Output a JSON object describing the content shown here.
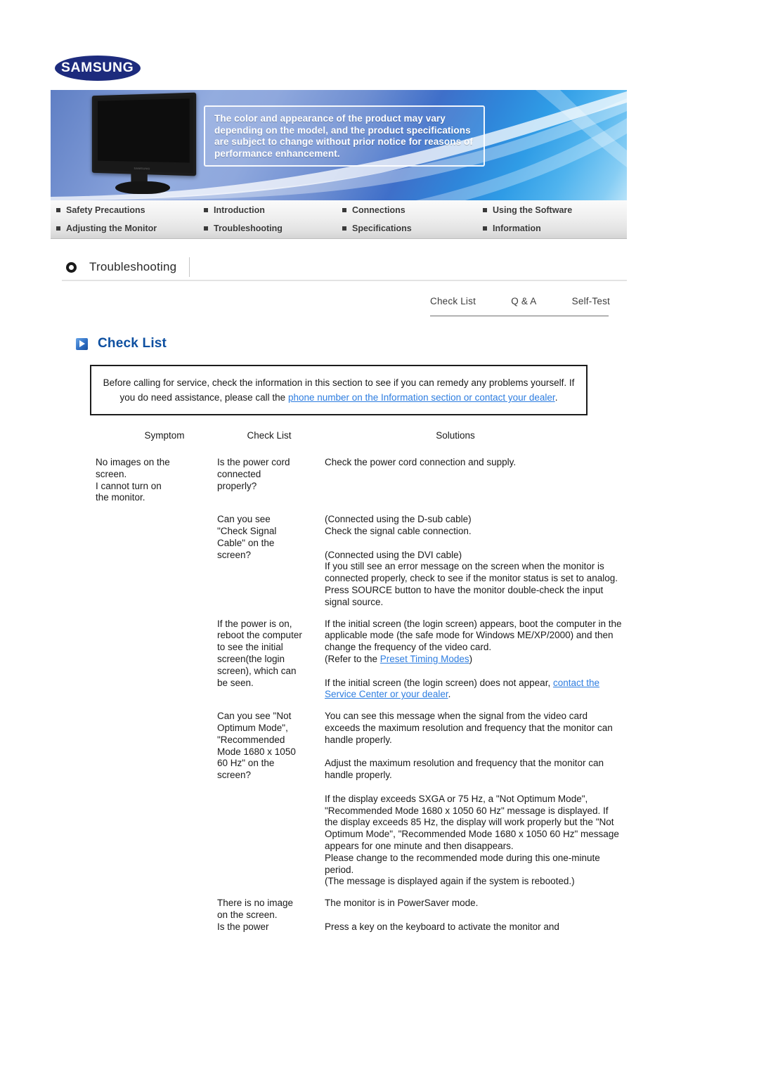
{
  "brand": {
    "logo_text": "SAMSUNG"
  },
  "banner": {
    "note": "The color and appearance of the product may vary depending on the model, and the product specifications are subject to change without prior notice for reasons of performance enhancement."
  },
  "nav": {
    "items": [
      {
        "label": "Safety Precautions",
        "col": 0,
        "row": 0
      },
      {
        "label": "Introduction",
        "col": 1,
        "row": 0
      },
      {
        "label": "Connections",
        "col": 2,
        "row": 0
      },
      {
        "label": "Using the Software",
        "col": 3,
        "row": 0
      },
      {
        "label": "Adjusting the Monitor",
        "col": 0,
        "row": 1
      },
      {
        "label": "Troubleshooting",
        "col": 1,
        "row": 1
      },
      {
        "label": "Specifications",
        "col": 2,
        "row": 1
      },
      {
        "label": "Information",
        "col": 3,
        "row": 1
      }
    ]
  },
  "section": {
    "title": "Troubleshooting"
  },
  "subtabs": [
    {
      "label": "Check List"
    },
    {
      "label": "Q & A"
    },
    {
      "label": "Self-Test"
    }
  ],
  "page_heading": {
    "title": "Check List",
    "icon": "blue-play-square-icon"
  },
  "intro": {
    "part1": "Before calling for service, check the information in this section to see if you can remedy any problems yourself. If you do need assistance, please call the ",
    "link": "phone number on the Information section or contact your dealer",
    "part2": "."
  },
  "table": {
    "headers": {
      "symptom": "Symptom",
      "check_list": "Check List",
      "solutions": "Solutions"
    },
    "rows": [
      {
        "symptom": "No images on the\nscreen.\nI cannot turn on\nthe monitor.",
        "check": "Is the power cord\nconnected\nproperly?",
        "solution_blocks": [
          "Check the power cord connection and supply."
        ]
      },
      {
        "symptom": "",
        "check": "Can you see\n\"Check Signal\nCable\" on the\nscreen?",
        "solution_blocks": [
          "(Connected using the D-sub cable)\nCheck the signal cable connection.",
          "(Connected using the DVI cable)\nIf you still see an error message on the screen when the monitor is connected properly, check to see if the monitor status is set to analog.\nPress SOURCE button to have the monitor double-check the input signal source."
        ]
      },
      {
        "symptom": "",
        "check": "If the power is on,\nreboot the computer\nto see the initial\nscreen(the login\nscreen), which can\nbe seen.",
        "solution_blocks": [],
        "solution_rich": true,
        "rich": {
          "b1_pre": "If the initial screen (the login screen) appears, boot the computer in the applicable mode (the safe mode for Windows ME/XP/2000) and then change the frequency of the video card.\n(Refer to the ",
          "b1_link": "Preset Timing Modes",
          "b1_post": ")",
          "b2_pre": "If the initial screen (the login screen) does not appear, ",
          "b2_link": "contact the Service Center or your dealer",
          "b2_post": "."
        }
      },
      {
        "symptom": "",
        "check": "Can you see \"Not\nOptimum Mode\",\n\"Recommended\nMode 1680 x 1050\n60 Hz\" on the\nscreen?",
        "solution_blocks": [
          "You can see this message when the signal from the video card exceeds the maximum resolution and frequency that the monitor can handle properly.",
          "Adjust the maximum resolution and frequency that the monitor can handle properly.",
          "If the display exceeds SXGA or 75 Hz, a \"Not Optimum Mode\", \"Recommended Mode 1680 x 1050 60 Hz\" message is displayed. If the display exceeds 85 Hz, the display will work properly but the \"Not Optimum Mode\", \"Recommended Mode 1680 x 1050 60 Hz\" message appears for one minute and then disappears.\nPlease change to the recommended mode during this one-minute period.\n(The message is displayed again if the system is rebooted.)"
        ]
      },
      {
        "symptom": "",
        "check": "There is no image\non the screen.\nIs the power",
        "solution_blocks": [
          "The monitor is in PowerSaver mode.",
          "Press a key on the keyboard to activate the monitor and"
        ]
      }
    ]
  },
  "colors": {
    "brand_navy": "#1d2b7d",
    "heading_blue": "#0d4fa0",
    "link_blue": "#2d7de0"
  }
}
